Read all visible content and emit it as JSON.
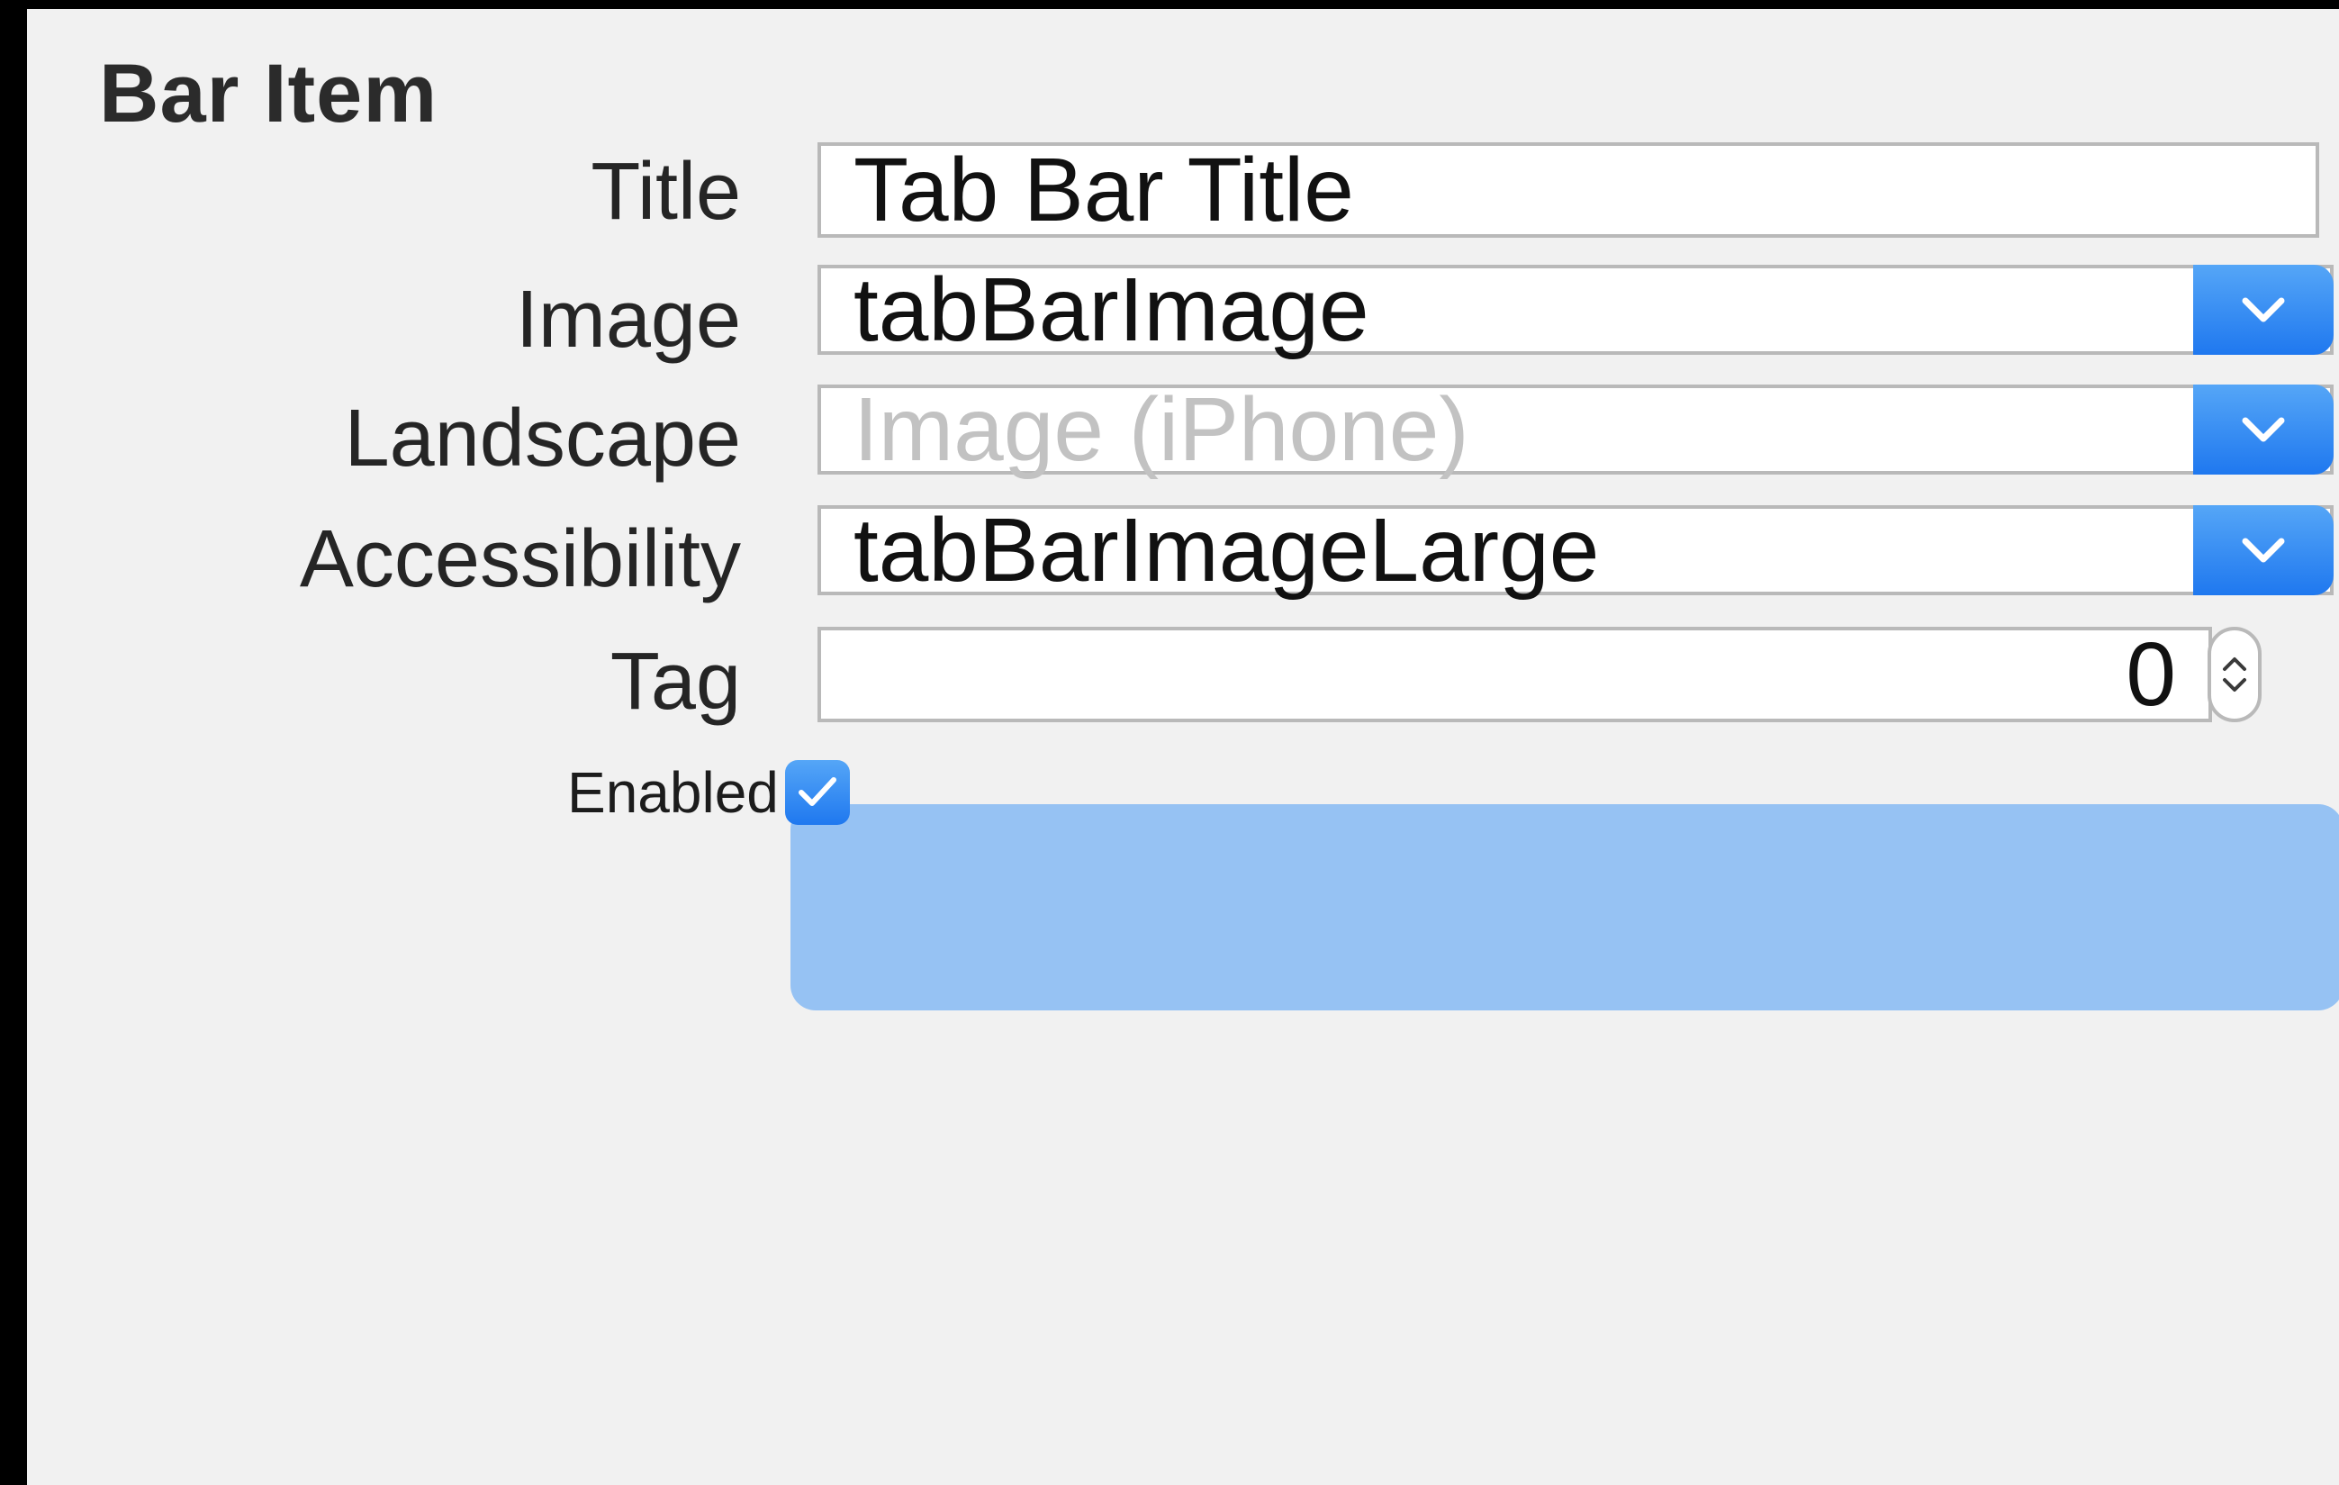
{
  "section": {
    "title": "Bar Item"
  },
  "fields": {
    "title": {
      "label": "Title",
      "value": "Tab Bar Title"
    },
    "image": {
      "label": "Image",
      "value": "tabBarImage"
    },
    "landscape": {
      "label": "Landscape",
      "placeholder": "Image (iPhone)"
    },
    "accessibility": {
      "label": "Accessibility",
      "value": "tabBarImageLarge"
    },
    "tag": {
      "label": "Tag",
      "value": "0"
    }
  },
  "enabled": {
    "label": "Enabled",
    "checked": true
  },
  "colors": {
    "accent": "#2a85f2",
    "focus_ring": "#96c2f3",
    "panel_bg": "#f1f1f1"
  },
  "icons": {
    "popup": "chevron-down-icon",
    "stepper_up": "chevron-up-icon",
    "stepper_down": "chevron-down-icon",
    "check": "checkmark-icon"
  }
}
